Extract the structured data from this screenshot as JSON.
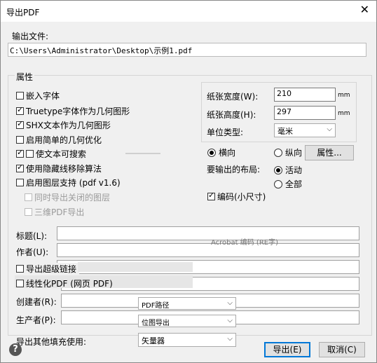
{
  "window": {
    "title": "导出PDF",
    "close_glyph": "✕"
  },
  "output_file": {
    "label": "输出文件:",
    "path": "C:\\Users\\Administrator\\Desktop\\示例1.pdf"
  },
  "properties": {
    "title": "属性",
    "options": [
      {
        "label": "嵌入字体",
        "checked": false,
        "disabled": false
      },
      {
        "label": "Truetype字体作为几何图形",
        "checked": true,
        "disabled": false
      },
      {
        "label": "SHX文本作为几何图形",
        "checked": true,
        "disabled": false
      },
      {
        "label": "启用简单的几何优化",
        "checked": false,
        "disabled": false
      },
      {
        "label": "使文本可搜索",
        "checked": true,
        "disabled": false
      },
      {
        "label": "使用隐藏线移除算法",
        "checked": true,
        "disabled": false
      },
      {
        "label": "启用图层支持 (pdf v1.6)",
        "checked": false,
        "disabled": false
      },
      {
        "label": "同时导出关闭的图层",
        "checked": false,
        "disabled": true
      },
      {
        "label": "三维PDF导出",
        "checked": false,
        "disabled": true
      }
    ]
  },
  "paper": {
    "width_label": "纸张宽度(W):",
    "width_value": "210",
    "width_unit": "mm",
    "height_label": "纸张高度(H):",
    "height_value": "297",
    "height_unit": "mm",
    "unit_label": "单位类型:",
    "unit_value": "毫米"
  },
  "orientation": {
    "landscape": "横向",
    "portrait": "纵向",
    "properties_button": "属性..."
  },
  "layout": {
    "label": "要输出的布局:",
    "active": "活动",
    "all": "全部"
  },
  "encoding": {
    "label": "编码(小尺寸)",
    "checked": true
  },
  "meta": {
    "title_label": "标题(L):",
    "title_value": "",
    "author_label": "作者(U):",
    "author_value": "",
    "hyperlinks_label": "导出超级链接",
    "linearize_label": "线性化PDF (网页 PDF)",
    "creator_label": "创建者(R):",
    "creator_value": "",
    "producer_label": "生产者(P):",
    "producer_value": "",
    "fill_label": "导出其他填充使用:",
    "fill_value": "矢量器",
    "ghost_pdf_path": "PDF路径",
    "ghost_bitmap": "位图导出",
    "ghost_text1": "Acrobat 编码 (RE字)"
  },
  "buttons": {
    "export": "导出(E)",
    "cancel": "取消(C)",
    "help": "?"
  }
}
